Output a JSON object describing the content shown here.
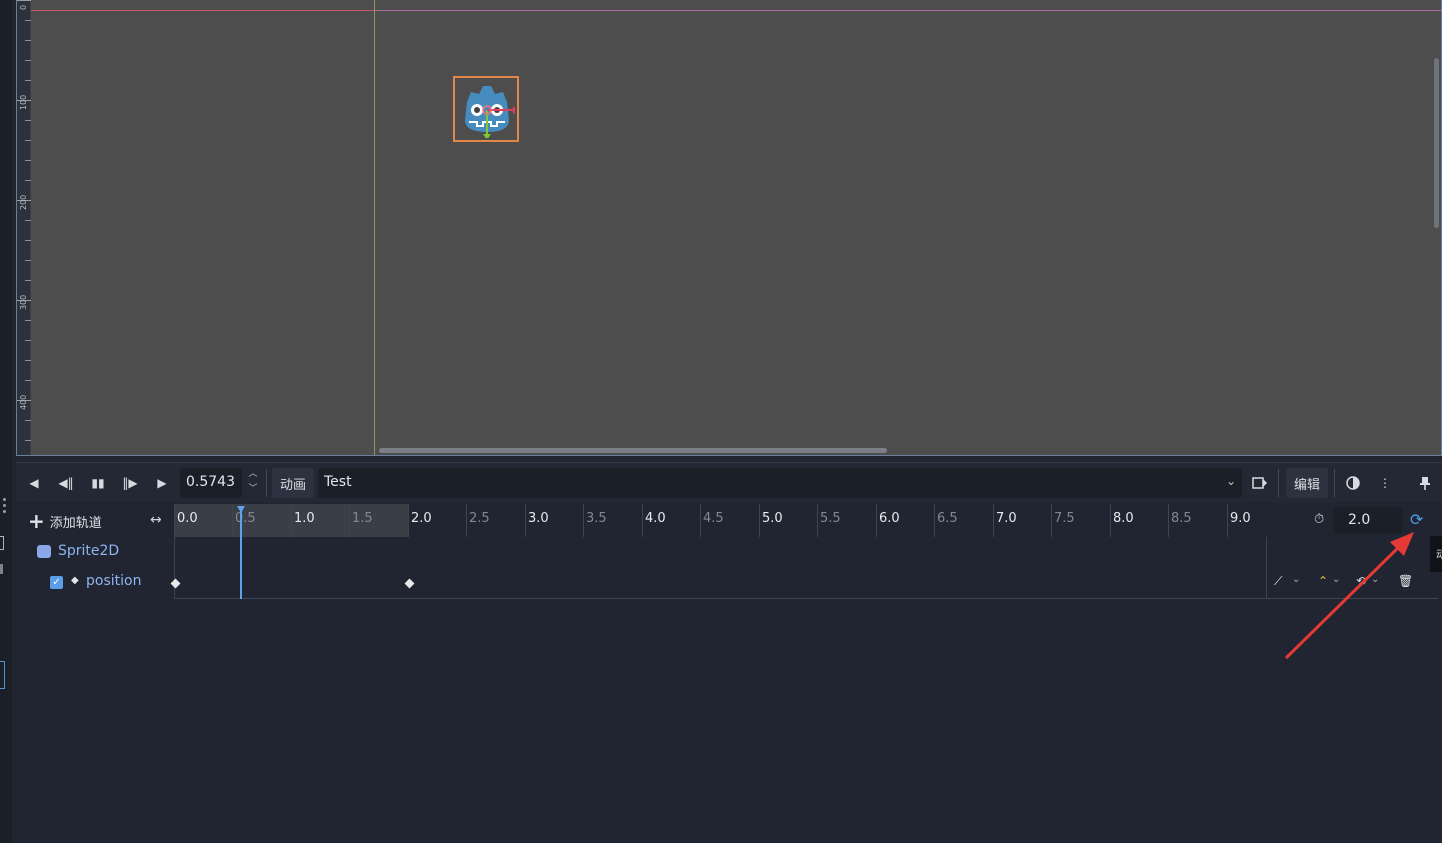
{
  "viewport": {
    "ruler_labels": [
      "0",
      "100",
      "200",
      "300",
      "400"
    ]
  },
  "toolbar": {
    "time_value": "0.5743",
    "anim_label": "动画",
    "animation_name": "Test",
    "edit_label": "编辑"
  },
  "track_header": {
    "add_track_label": "添加轨道",
    "length_value": "2.0",
    "timeline_labels": [
      "0.0",
      "0.5",
      "1.0",
      "1.5",
      "2.0",
      "2.5",
      "3.0",
      "3.5",
      "4.0",
      "4.5",
      "5.0",
      "5.5",
      "6.0",
      "6.5",
      "7.0",
      "7.5",
      "8.0",
      "8.5",
      "9.0"
    ]
  },
  "tracks": {
    "node_name": "Sprite2D",
    "property_name": "position"
  },
  "tooltip": {
    "text": "动"
  },
  "colors": {
    "accent": "#5da3ea",
    "arrow": "#e53935",
    "selection": "#e0884a"
  }
}
